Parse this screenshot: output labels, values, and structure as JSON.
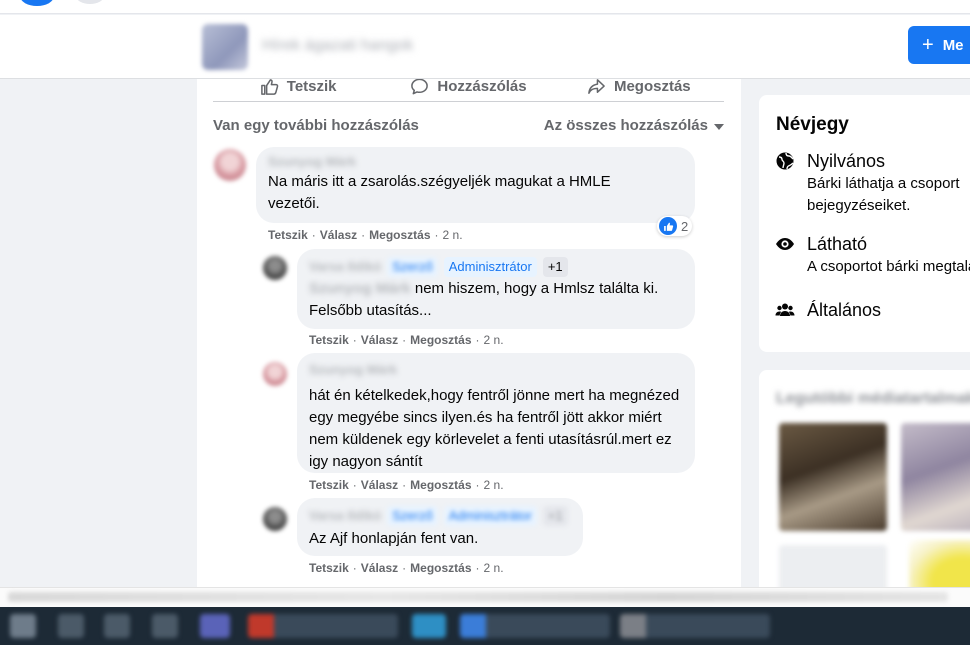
{
  "header": {
    "group_name": "Hírek ágazati hangok",
    "new_button_label": "Me",
    "new_button_icon": "plus-icon"
  },
  "post_actions": [
    {
      "label": "Tetszik",
      "icon": "like-icon"
    },
    {
      "label": "Hozzászólás",
      "icon": "comment-icon"
    },
    {
      "label": "Megosztás",
      "icon": "share-icon"
    }
  ],
  "comments_header": {
    "more_label": "Van egy további hozzászólás",
    "filter_label": "Az összes hozzászólás"
  },
  "comments": [
    {
      "author": "Szunyog Márk",
      "text": "Na máris itt a zsarolás.szégyeljék magukat a HMLE vezetői.",
      "reaction_count": "2",
      "like": "Tetszik",
      "reply": "Válasz",
      "share": "Megosztás",
      "time": "2 n."
    },
    {
      "author": "Varsa Ildikó",
      "badge_author": "Szerző",
      "badge_admin": "Adminisztrátor",
      "badge_more": "+1",
      "mention": "Szunyog Márk",
      "text": "nem hiszem, hogy a Hmlsz találta ki. Felsőbb utasítás...",
      "like": "Tetszik",
      "reply": "Válasz",
      "share": "Megosztás",
      "time": "2 n."
    },
    {
      "author": "Szunyog Márk",
      "text": "hát én kételkedek,hogy fentről jönne mert ha megnézed egy megyébe sincs ilyen.és ha fentről jött akkor miért nem küldenek egy körlevelet a fenti utasításrúl.mert ez igy nagyon sántít",
      "like": "Tetszik",
      "reply": "Válasz",
      "share": "Megosztás",
      "time": "2 n."
    },
    {
      "author": "Varsa Ildikó",
      "badge_author": "Szerző",
      "badge_admin": "Adminisztrátor",
      "badge_more": "+1",
      "text": "Az Ajf honlapján fent van.",
      "like": "Tetszik",
      "reply": "Válasz",
      "share": "Megosztás",
      "time": "2 n."
    }
  ],
  "about": {
    "title": "Névjegy",
    "items": [
      {
        "icon": "globe-icon",
        "title": "Nyilvános",
        "desc": "Bárki láthatja a csoport bejegyzéseiket."
      },
      {
        "icon": "eye-icon",
        "title": "Látható",
        "desc": "A csoportot bárki megtalálhatja."
      },
      {
        "icon": "people-icon",
        "title": "Általános",
        "desc": ""
      }
    ]
  },
  "media": {
    "title": "Legutóbbi médiatartalmak"
  },
  "colors": {
    "accent": "#1877f2",
    "page_bg": "#f0f2f5",
    "secondary_text": "#65676b"
  }
}
